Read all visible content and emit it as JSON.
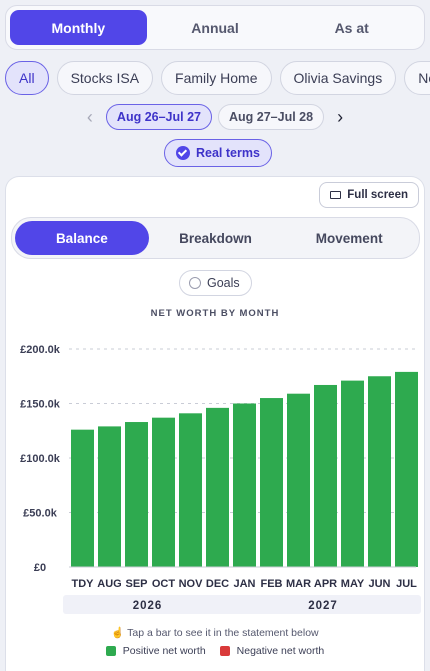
{
  "view_tabs": [
    "Monthly",
    "Annual",
    "As at"
  ],
  "accounts": [
    "All",
    "Stocks ISA",
    "Family Home",
    "Olivia Savings",
    "No"
  ],
  "periods": [
    "Aug 26–Jul 27",
    "Aug 27–Jul 28"
  ],
  "nav": {
    "prev_icon": "chevron-left-icon",
    "next_icon": "chevron-right-icon"
  },
  "real_terms_label": "Real terms",
  "full_screen_label": "Full screen",
  "chart_tabs": [
    "Balance",
    "Breakdown",
    "Movement"
  ],
  "goals_label": "Goals",
  "chart_title": "NET WORTH BY MONTH",
  "tap_hint": "Tap a bar to see it in the statement below",
  "colors": {
    "accent": "#5146e8",
    "positive": "#2eaa4f",
    "negative": "#d93a3a"
  },
  "chart_data": {
    "type": "bar",
    "title": "NET WORTH BY MONTH",
    "categories": [
      "TDY",
      "AUG",
      "SEP",
      "OCT",
      "NOV",
      "DEC",
      "JAN",
      "FEB",
      "MAR",
      "APR",
      "MAY",
      "JUN",
      "JUL"
    ],
    "values": [
      126000,
      129000,
      133000,
      137000,
      141000,
      146000,
      150000,
      155000,
      159000,
      167000,
      171000,
      175000,
      179000
    ],
    "year_groups": [
      {
        "label": "2026",
        "first": 0,
        "last": 5
      },
      {
        "label": "2027",
        "first": 6,
        "last": 12
      }
    ],
    "ylim": [
      0,
      200000
    ],
    "yticks": [
      0,
      50000,
      100000,
      150000,
      200000
    ],
    "ytick_labels": [
      "£0",
      "£50.0k",
      "£100.0k",
      "£150.0k",
      "£200.0k"
    ],
    "grid": true,
    "legend": [
      {
        "name": "Positive net worth",
        "color": "#2eaa4f"
      },
      {
        "name": "Negative net worth",
        "color": "#d93a3a"
      }
    ]
  }
}
